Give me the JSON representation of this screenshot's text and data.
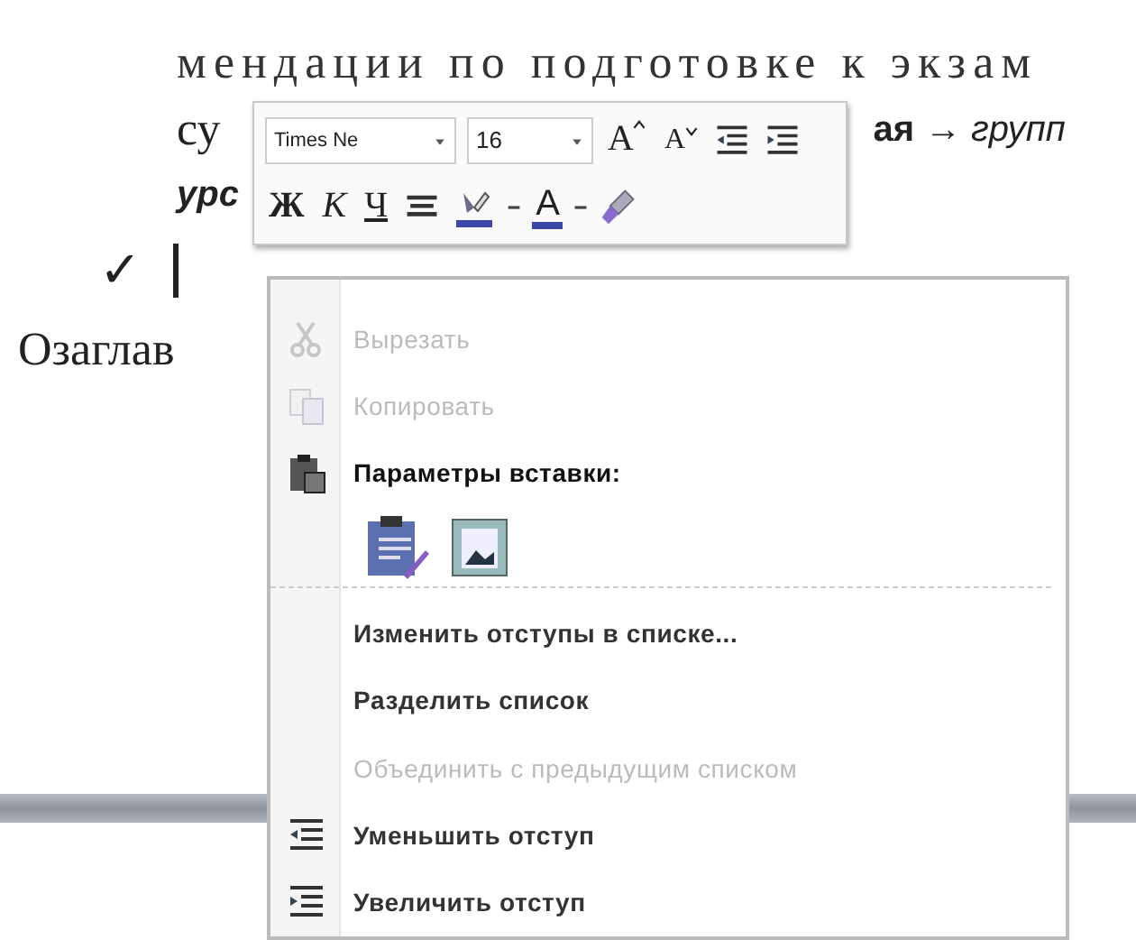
{
  "document": {
    "lines": [
      {
        "kind": "plain",
        "text": "мендации по подготовке к экзам"
      },
      {
        "kind": "split",
        "text": "су",
        "after": "ая",
        "after_italic": "→ групп"
      },
      {
        "kind": "bold-italic",
        "text": "урс"
      },
      {
        "kind": "check",
        "text": "✓"
      },
      {
        "kind": "plain",
        "text": "Озаглав"
      }
    ]
  },
  "mini_toolbar": {
    "font": "Times Ne",
    "size": "16",
    "grow_label": "A",
    "shrink_label": "A",
    "format_buttons": [
      {
        "kind": "bold",
        "label": "Ж"
      },
      {
        "kind": "italic",
        "label": "К"
      },
      {
        "kind": "underline",
        "label": "Ч"
      }
    ],
    "color_label": "A"
  },
  "context_menu": {
    "items": [
      {
        "kind": "item",
        "label": "Вырезать",
        "disabled": true
      },
      {
        "kind": "item",
        "label": "Копировать",
        "disabled": true
      },
      {
        "kind": "header",
        "label": "Параметры вставки:"
      },
      {
        "kind": "paste-options"
      },
      {
        "kind": "item",
        "label": "Изменить отступы в списке...",
        "disabled": false
      },
      {
        "kind": "item",
        "label": "Разделить список",
        "disabled": false
      },
      {
        "kind": "item",
        "label": "Объединить с предыдущим списком",
        "disabled": true
      },
      {
        "kind": "item",
        "label": "Уменьшить отступ",
        "disabled": false
      },
      {
        "kind": "item",
        "label": "Увеличить отступ",
        "disabled": false
      }
    ]
  }
}
